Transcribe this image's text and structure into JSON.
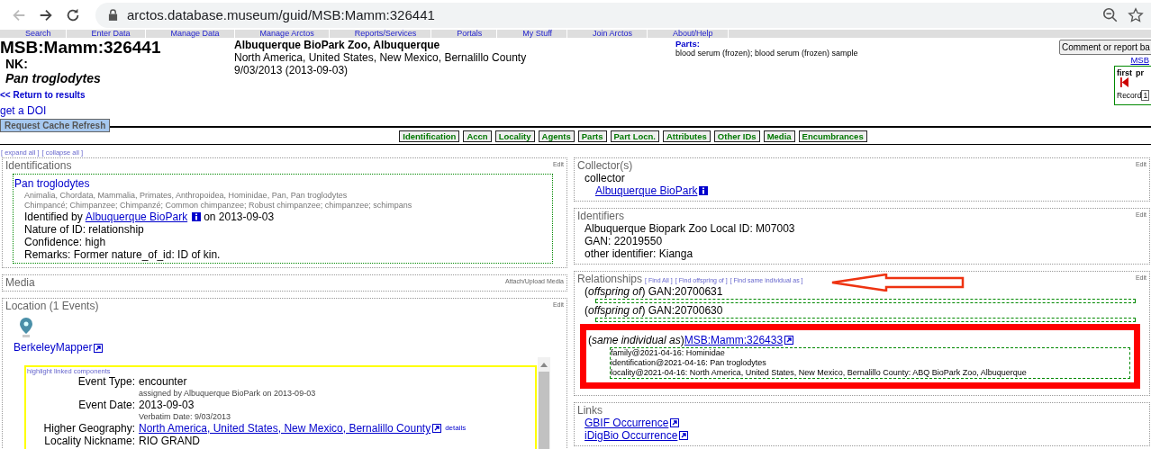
{
  "browser": {
    "url": "arctos.database.museum/guid/MSB:Mamm:326441"
  },
  "menu": [
    "Search",
    "Enter Data",
    "Manage Data",
    "Manage Arctos",
    "Reports/Services",
    "Portals",
    "My Stuff",
    "Join Arctos",
    "About/Help"
  ],
  "header": {
    "guid": "MSB:Mamm:326441",
    "nature_label": "NK:",
    "taxon": "Pan troglodytes",
    "return_link": "<< Return to results",
    "doi_link": "get a DOI",
    "refresh_button": "Request Cache Refresh",
    "locality_title": "Albuquerque BioPark Zoo, Albuquerque",
    "geography": "North America, United States, New Mexico, Bernalillo County",
    "date": "9/03/2013 (2013-09-03)",
    "parts_label": "Parts:",
    "parts": "blood serum (frozen); blood serum (frozen) sample",
    "comment_button": "Comment or report ba",
    "related_link": "MSB",
    "pager": {
      "first": "first",
      "next": "pr",
      "record_label": "Record",
      "record_value": "1"
    }
  },
  "section_nav": [
    "Identification",
    "Accn",
    "Locality",
    "Agents",
    "Parts",
    "Part Locn.",
    "Attributes",
    "Other IDs",
    "Media",
    "Encumbrances"
  ],
  "expand_all": "[ expand all ]",
  "collapse_all": "[ collapse all ]",
  "identifications": {
    "title": "Identifications",
    "edit": "Edit",
    "taxon": "Pan troglodytes",
    "classification": "Animalia, Chordata, Mammalia, Primates, Anthropoidea, Hominidae, Pan, Pan troglodytes",
    "common_names": "Chimpancé; Chimpanzee; Chimpanzé; Common chimpanzee; Robust chimpanzee; chimpanzee; schimpans",
    "identified_by_prefix": "Identified by",
    "identified_by_agent": "Albuquerque BioPark",
    "identified_by_date": "on 2013-09-03",
    "lines": [
      "Nature of ID: relationship",
      "Confidence: high",
      "Remarks: Former nature_of_id: ID of kin."
    ]
  },
  "media": {
    "title": "Media",
    "action": "Attach/Upload Media"
  },
  "location": {
    "title": "Location (1 Events)",
    "edit": "Edit",
    "mapper_link": "BerkeleyMapper",
    "highlight_link": "highlight linked components",
    "fields": [
      {
        "kind": "text",
        "label": "Event Type:",
        "value": "encounter",
        "note": "assigned by Albuquerque BioPark on 2013-09-03"
      },
      {
        "kind": "text",
        "label": "Event Date:",
        "value": "2013-09-03",
        "note": "Verbatim Date: 9/03/2013"
      },
      {
        "kind": "link",
        "label": "Higher Geography:",
        "value": "North America, United States, New Mexico, Bernalillo County",
        "extra": "details"
      },
      {
        "kind": "text",
        "label": "Locality Nickname:",
        "value": "RIO GRAND"
      }
    ]
  },
  "collectors": {
    "title": "Collector(s)",
    "edit": "Edit",
    "role": "collector",
    "agent": "Albuquerque BioPark"
  },
  "identifiers": {
    "title": "Identifiers",
    "edit": "Edit",
    "lines": [
      "Albuquerque Biopark Zoo Local ID: M07003",
      "GAN: 22019550",
      "other identifier: Kianga"
    ]
  },
  "relationships": {
    "title": "Relationships",
    "edit": "Edit",
    "links": [
      "[ Find All ]",
      "[ Find offspring of ]",
      "[ Find same individual as ]"
    ],
    "items": [
      {
        "kind": "text",
        "relation": "(*offspring of*)",
        "target": "GAN:20700631",
        "highlighted": false
      },
      {
        "kind": "text",
        "relation": "(*offspring of*)",
        "target": "GAN:20700630",
        "highlighted": false
      },
      {
        "kind": "link",
        "relation": "(*same individual as*)",
        "target": "MSB:Mamm:326433",
        "highlighted": true,
        "details": [
          "family@2021-04-16: Hominidae",
          "identification@2021-04-16: Pan troglodytes",
          "locality@2021-04-16: North America, United States, New Mexico, Bernalillo County: ABQ BioPark Zoo, Albuquerque"
        ]
      }
    ]
  },
  "links": {
    "title": "Links",
    "items": [
      "GBIF Occurrence",
      "iDigBio Occurrence"
    ]
  }
}
